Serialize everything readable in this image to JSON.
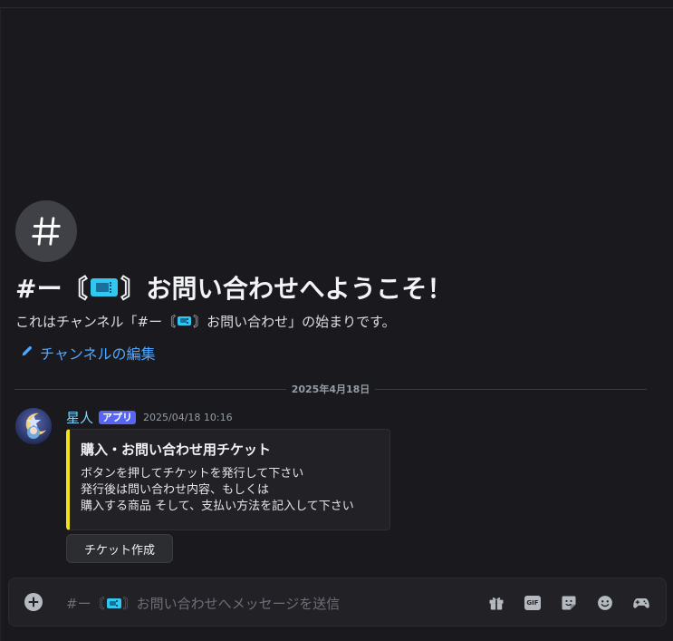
{
  "channel": {
    "welcome_prefix": "#ー〘",
    "welcome_suffix": "〙お問い合わせへようこそ！",
    "intro_prefix": "これはチャンネル「#ー〘",
    "intro_suffix": "〙お問い合わせ」の始まりです。",
    "edit_label": "チャンネルの編集"
  },
  "divider": {
    "date": "2025年4月18日"
  },
  "message": {
    "username": "星人",
    "badge": "アプリ",
    "timestamp": "2025/04/18 10:16",
    "embed": {
      "accent_color": "#f0e418",
      "title": "購入・お問い合わせ用チケット",
      "lines": [
        "ボタンを押してチケットを発行して下さい",
        "発行後は問い合わせ内容、もしくは",
        "購入する商品 そして、支払い方法を記入して下さい"
      ]
    },
    "button_label": "チケット作成"
  },
  "composer": {
    "placeholder_prefix": "#ー〘",
    "placeholder_suffix": "〙お問い合わせへメッセージを送信",
    "tools": [
      "gift-icon",
      "gif-icon",
      "sticker-icon",
      "emoji-icon",
      "apps-icon"
    ]
  },
  "colors": {
    "background": "#1a1a1e",
    "link": "#4fa6ff",
    "username": "#7dd3fc",
    "badge": "#5865f2"
  }
}
